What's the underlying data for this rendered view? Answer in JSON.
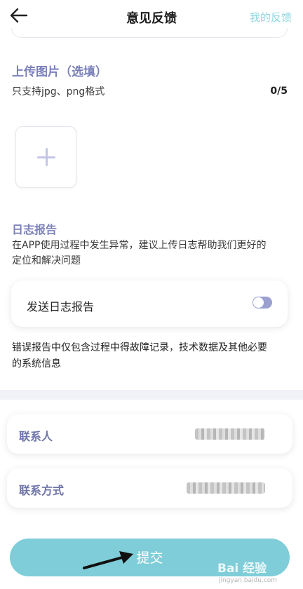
{
  "header": {
    "title": "意见反馈",
    "right_link": "我的反馈"
  },
  "upload": {
    "title": "上传图片（选填）",
    "hint": "只支持jpg、png格式",
    "count": "0/5"
  },
  "log": {
    "title": "日志报告",
    "desc_line1": "在APP使用过程中发生异常，建议上传日志帮助我们更好的",
    "desc_line2": "定位和解决问题",
    "toggle_label": "发送日志报告",
    "toggle_on": false,
    "note_line1": "错误报告中仅包含过程中得故障记录，技术数据及其他必要",
    "note_line2": "的系统信息"
  },
  "contact": {
    "name_label": "联系人",
    "method_label": "联系方式"
  },
  "submit_label": "提交",
  "watermark": {
    "brand": "Bai 经验",
    "url": "jingyan.baidu.com"
  },
  "colors": {
    "accent": "#7fcdd8",
    "section_title": "#7b81b8",
    "link": "#8ed6df"
  }
}
